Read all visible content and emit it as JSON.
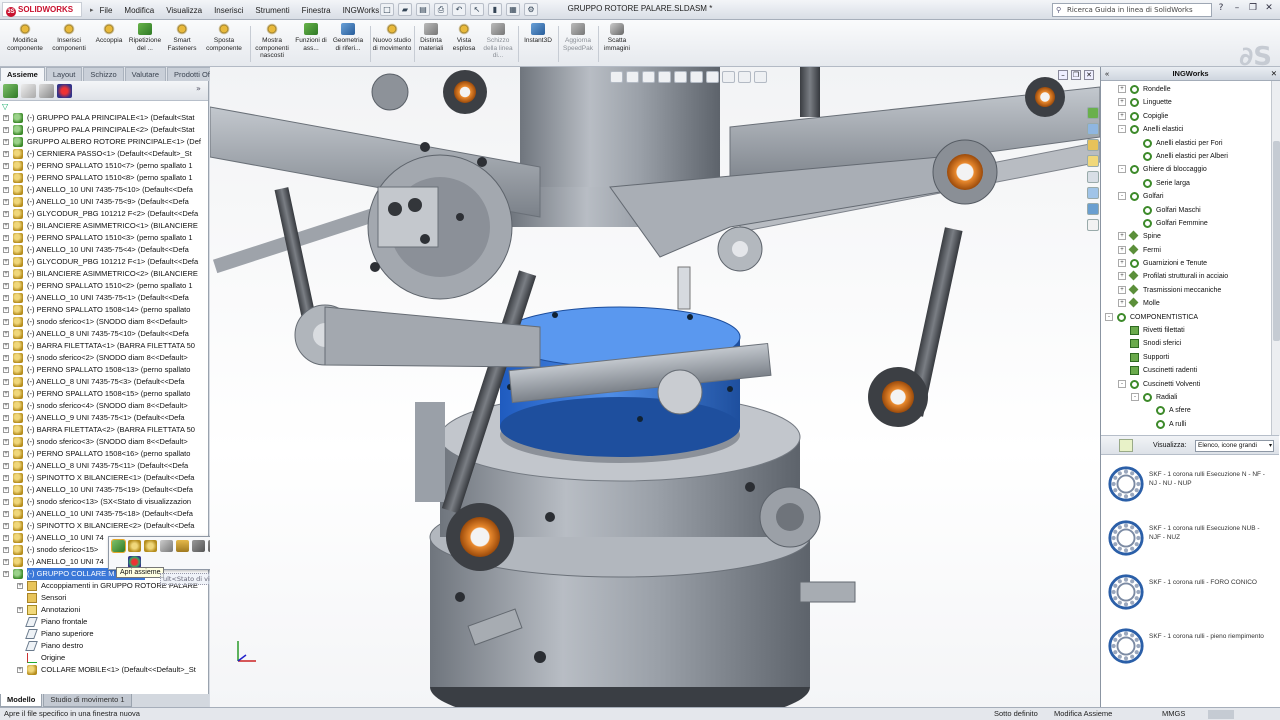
{
  "app": {
    "logo_text": "SOLIDWORKS",
    "document_title": "GRUPPO ROTORE PALARE.SLDASM *"
  },
  "menu": [
    "File",
    "Modifica",
    "Visualizza",
    "Inserisci",
    "Strumenti",
    "Finestra",
    "INGWorks"
  ],
  "search": {
    "placeholder": "Ricerca Guida in linea di SolidWorks"
  },
  "command_manager": [
    {
      "label": "Modifica componente",
      "icon": "edit-component-icon",
      "enabled": true
    },
    {
      "label": "Inserisci componenti",
      "icon": "insert-components-icon",
      "enabled": true
    },
    {
      "label": "Accoppia",
      "icon": "mate-icon",
      "enabled": true
    },
    {
      "label": "Ripetizione del ...",
      "icon": "linear-pattern-icon",
      "enabled": true
    },
    {
      "label": "Smart Fasteners",
      "icon": "smart-fasteners-icon",
      "enabled": true
    },
    {
      "label": "Sposta componente",
      "icon": "move-component-icon",
      "enabled": true
    },
    {
      "label": "Mostra componenti nascosti",
      "icon": "show-hidden-icon",
      "enabled": true
    },
    {
      "label": "Funzioni di ass...",
      "icon": "assembly-features-icon",
      "enabled": true
    },
    {
      "label": "Geometria di riferi...",
      "icon": "reference-geometry-icon",
      "enabled": true
    },
    {
      "label": "Nuovo studio di movimento",
      "icon": "motion-study-icon",
      "enabled": true
    },
    {
      "label": "Distinta materiali",
      "icon": "bom-icon",
      "enabled": true
    },
    {
      "label": "Vista esplosa",
      "icon": "exploded-view-icon",
      "enabled": true
    },
    {
      "label": "Schizzo della linea di...",
      "icon": "explode-line-icon",
      "enabled": false
    },
    {
      "label": "Instant3D",
      "icon": "instant3d-icon",
      "enabled": true
    },
    {
      "label": "Aggiorna SpeedPak",
      "icon": "speedpak-icon",
      "enabled": false
    },
    {
      "label": "Scatta immagini",
      "icon": "camera-icon",
      "enabled": true
    }
  ],
  "tabs": [
    "Assieme",
    "Layout",
    "Schizzo",
    "Valutare",
    "Prodotti Office"
  ],
  "tree": {
    "items": [
      {
        "label": "(-) GRUPPO PALA PRINCIPALE<1> (Default<Stat",
        "kind": "asm",
        "expandable": true
      },
      {
        "label": "(-) GRUPPO PALA PRINCIPALE<2> (Default<Stat",
        "kind": "asm",
        "expandable": true
      },
      {
        "label": "GRUPPO ALBERO ROTORE PRINCIPALE<1> (Def",
        "kind": "asm",
        "expandable": true
      },
      {
        "label": "(-) CERNIERA PASSO<1> (Default<<Default>_St",
        "kind": "part",
        "expandable": true
      },
      {
        "label": "(-) PERNO SPALLATO 1510<7> (perno spallato 1",
        "kind": "part",
        "expandable": true
      },
      {
        "label": "(-) PERNO SPALLATO 1510<8> (perno spallato 1",
        "kind": "part",
        "expandable": true
      },
      {
        "label": "(-) ANELLO_10  UNI 7435-75<10> (Default<<Defa",
        "kind": "part",
        "expandable": true
      },
      {
        "label": "(-) ANELLO_10  UNI 7435-75<9> (Default<<Defa",
        "kind": "part",
        "expandable": true
      },
      {
        "label": "(-) GLYCODUR_PBG 101212 F<2> (Default<<Defa",
        "kind": "part",
        "expandable": true
      },
      {
        "label": "(-) BILANCIERE ASIMMETRICO<1> (BILANCIERE",
        "kind": "part",
        "expandable": true
      },
      {
        "label": "(-) PERNO SPALLATO 1510<3> (perno spallato 1",
        "kind": "part",
        "expandable": true
      },
      {
        "label": "(-) ANELLO_10  UNI 7435-75<4> (Default<<Defa",
        "kind": "part",
        "expandable": true
      },
      {
        "label": "(-) GLYCODUR_PBG 101212 F<1> (Default<<Defa",
        "kind": "part",
        "expandable": true
      },
      {
        "label": "(-) BILANCIERE ASIMMETRICO<2> (BILANCIERE",
        "kind": "part",
        "expandable": true
      },
      {
        "label": "(-) PERNO SPALLATO 1510<2> (perno spallato 1",
        "kind": "part",
        "expandable": true
      },
      {
        "label": "(-) ANELLO_10  UNI 7435-75<1> (Default<<Defa",
        "kind": "part",
        "expandable": true
      },
      {
        "label": "(-) PERNO SPALLATO 1508<14> (perno spallato",
        "kind": "part",
        "expandable": true
      },
      {
        "label": "(-) snodo sferico<1> (SNODO diam 8<<Default>",
        "kind": "part",
        "expandable": true
      },
      {
        "label": "(-) ANELLO_8  UNI 7435-75<10> (Default<<Defa",
        "kind": "part",
        "expandable": true
      },
      {
        "label": "(-) BARRA FILETTATA<1> (BARRA FILETTATA 50",
        "kind": "part",
        "expandable": true
      },
      {
        "label": "(-) snodo sferico<2> (SNODO diam 8<<Default>",
        "kind": "part",
        "expandable": true
      },
      {
        "label": "(-) PERNO SPALLATO 1508<13> (perno spallato",
        "kind": "part",
        "expandable": true
      },
      {
        "label": "(-) ANELLO_8  UNI 7435-75<3> (Default<<Defa",
        "kind": "part",
        "expandable": true
      },
      {
        "label": "(-) PERNO SPALLATO 1508<15> (perno spallato",
        "kind": "part",
        "expandable": true
      },
      {
        "label": "(-) snodo sferico<4> (SNODO diam 8<<Default>",
        "kind": "part",
        "expandable": true
      },
      {
        "label": "(-) ANELLO_9  UNI 7435-75<1> (Default<<Defa",
        "kind": "part",
        "expandable": true
      },
      {
        "label": "(-) BARRA FILETTATA<2> (BARRA FILETTATA 50",
        "kind": "part",
        "expandable": true
      },
      {
        "label": "(-) snodo sferico<3> (SNODO diam 8<<Default>",
        "kind": "part",
        "expandable": true
      },
      {
        "label": "(-) PERNO SPALLATO 1508<16> (perno spallato",
        "kind": "part",
        "expandable": true
      },
      {
        "label": "(-) ANELLO_8  UNI 7435-75<11> (Default<<Defa",
        "kind": "part",
        "expandable": true
      },
      {
        "label": "(-) SPINOTTO X BILANCIERE<1> (Default<<Defa",
        "kind": "part",
        "expandable": true
      },
      {
        "label": "(-) ANELLO_10  UNI 7435-75<19> (Default<<Defa",
        "kind": "part",
        "expandable": true
      },
      {
        "label": "(-) snodo sferico<13> (SX<Stato di visualizzazion",
        "kind": "part",
        "expandable": true
      },
      {
        "label": "(-) ANELLO_10  UNI 7435-75<18> (Default<<Defa",
        "kind": "part",
        "expandable": true
      },
      {
        "label": "(-) SPINOTTO X BILANCIERE<2> (Default<<Defa",
        "kind": "part",
        "expandable": true
      },
      {
        "label": "(-) ANELLO_10  UNI 74",
        "kind": "part",
        "expandable": true
      },
      {
        "label": "(-) snodo sferico<15>",
        "kind": "part",
        "expandable": true
      },
      {
        "label": "(-) ANELLO_10  UNI 74",
        "kind": "part",
        "expandable": true
      },
      {
        "label": "(-) GRUPPO COLLARE M",
        "kind": "asm",
        "expandable": true,
        "selected": true
      },
      {
        "label": "Accoppiamenti in GRUPPO ROTORE PALARE",
        "kind": "folder",
        "expandable": true,
        "sub": true
      },
      {
        "label": "Sensori",
        "kind": "folder",
        "expandable": false,
        "sub": true
      },
      {
        "label": "Annotazioni",
        "kind": "annot",
        "expandable": true,
        "sub": true
      },
      {
        "label": "Piano frontale",
        "kind": "plane",
        "expandable": false,
        "sub": true
      },
      {
        "label": "Piano superiore",
        "kind": "plane",
        "expandable": false,
        "sub": true
      },
      {
        "label": "Piano destro",
        "kind": "plane",
        "expandable": false,
        "sub": true
      },
      {
        "label": "Origine",
        "kind": "origin",
        "expandable": false,
        "sub": true
      },
      {
        "label": "COLLARE MOBILE<1> (Default<<Default>_St",
        "kind": "part",
        "expandable": true,
        "sub": true
      }
    ]
  },
  "context_toolbar": {
    "tooltip": "Apri assieme",
    "ghost_text": "ult<Stato di visualizzazione-1>"
  },
  "bottom_tabs": [
    "Modello",
    "Studio di movimento 1"
  ],
  "task_pane": {
    "title": "INGWorks",
    "library": [
      {
        "label": "Rondelle",
        "depth": 1,
        "icon": "gring",
        "exp": "+"
      },
      {
        "label": "Linguette",
        "depth": 1,
        "icon": "gring",
        "exp": "+"
      },
      {
        "label": "Copiglie",
        "depth": 1,
        "icon": "gring",
        "exp": "+"
      },
      {
        "label": "Anelli elastici",
        "depth": 1,
        "icon": "gring",
        "exp": "-"
      },
      {
        "label": "Anelli elastici per Fori",
        "depth": 2,
        "icon": "gring",
        "exp": ""
      },
      {
        "label": "Anelli elastici per Alberi",
        "depth": 2,
        "icon": "gring",
        "exp": ""
      },
      {
        "label": "Ghiere di bloccaggio",
        "depth": 1,
        "icon": "gring",
        "exp": "-"
      },
      {
        "label": "Serie larga",
        "depth": 2,
        "icon": "gring",
        "exp": ""
      },
      {
        "label": "Golfari",
        "depth": 1,
        "icon": "gring",
        "exp": "-"
      },
      {
        "label": "Golfari Maschi",
        "depth": 2,
        "icon": "gring",
        "exp": ""
      },
      {
        "label": "Golfari Femmine",
        "depth": 2,
        "icon": "gring",
        "exp": ""
      },
      {
        "label": "Spine",
        "depth": 1,
        "icon": "gcube",
        "exp": "+"
      },
      {
        "label": "Fermi",
        "depth": 1,
        "icon": "gcube",
        "exp": "+"
      },
      {
        "label": "Guarnizioni e Tenute",
        "depth": 1,
        "icon": "gring",
        "exp": "+"
      },
      {
        "label": "Profilati strutturali in acciaio",
        "depth": 1,
        "icon": "gcube",
        "exp": "+"
      },
      {
        "label": "Trasmissioni meccaniche",
        "depth": 1,
        "icon": "gcube",
        "exp": "+"
      },
      {
        "label": "Molle",
        "depth": 1,
        "icon": "gcube",
        "exp": "+"
      },
      {
        "label": "COMPONENTISTICA",
        "depth": 0,
        "icon": "gring",
        "exp": "-"
      },
      {
        "label": "Rivetti filettati",
        "depth": 1,
        "icon": "gfold",
        "exp": ""
      },
      {
        "label": "Snodi sferici",
        "depth": 1,
        "icon": "gfold",
        "exp": ""
      },
      {
        "label": "Supporti",
        "depth": 1,
        "icon": "gfold",
        "exp": ""
      },
      {
        "label": "Cuscinetti radenti",
        "depth": 1,
        "icon": "gfold",
        "exp": ""
      },
      {
        "label": "Cuscinetti Volventi",
        "depth": 1,
        "icon": "gring",
        "exp": "-"
      },
      {
        "label": "Radiali",
        "depth": 2,
        "icon": "gring",
        "exp": "-"
      },
      {
        "label": "A sfere",
        "depth": 3,
        "icon": "gring",
        "exp": ""
      },
      {
        "label": "A rulli",
        "depth": 3,
        "icon": "gring",
        "exp": ""
      }
    ],
    "visualizza_label": "Visualizza:",
    "visualizza_value": "Elenco, icone grandi",
    "items": [
      {
        "caption": "SKF - 1 corona rulli Esecuzione N - NF - NJ - NU - NUP"
      },
      {
        "caption": "SKF - 1 corona rulli Esecuzione NUB - NJF - NUZ"
      },
      {
        "caption": "SKF - 1 corona rulli - FORO CONICO"
      },
      {
        "caption": "SKF - 1 corona rulli - pieno riempimento"
      }
    ]
  },
  "status_bar": {
    "message": "Apre il file specifico in una finestra nuova",
    "state": "Sotto definito",
    "mode": "Modifica Assieme",
    "units": "MMGS"
  },
  "colors": {
    "selection": "#3b78d8",
    "blue_part": "#2f6fd6",
    "metal": "#9aa0a8",
    "orange_bushing": "#e07a1c"
  }
}
